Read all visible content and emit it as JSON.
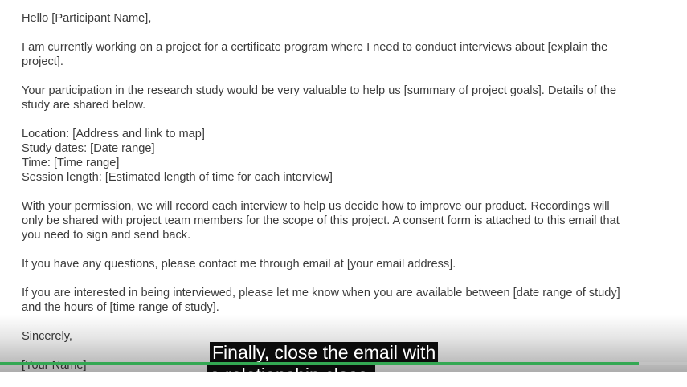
{
  "email": {
    "greeting": "Hello [Participant Name],",
    "intro": [
      "I am currently working on a project for a certificate program where I need to conduct interviews about [explain the",
      "project]."
    ],
    "participation": [
      "Your participation in the research study would be very valuable to help us [summary of project goals]. Details of the",
      "study are shared below."
    ],
    "details": {
      "location": "Location: [Address and link to map]",
      "study_dates": "Study dates: [Date range]",
      "time": "Time: [Time range]",
      "session_length": "Session length: [Estimated length of time for each interview]"
    },
    "permission": [
      "With your permission, we will record each interview to help us decide how to improve our product. Recordings will",
      "only be shared with project team members for the scope of this project. A consent form is attached to this email that",
      "you need to sign and send back."
    ],
    "questions": "If you have any questions, please contact me through email at [your email address].",
    "interest": [
      "If you are interested in being interviewed, please let me know when you are available between [date range of study]",
      "and the hours of [time range of study]."
    ],
    "closing": "Sincerely,",
    "signature": "[Your Name]"
  },
  "video": {
    "caption_line_1": "Finally, close the email with",
    "caption_line_2": "a relationship close.",
    "progress_fraction": 0.93,
    "progress_color": "#34a853"
  }
}
